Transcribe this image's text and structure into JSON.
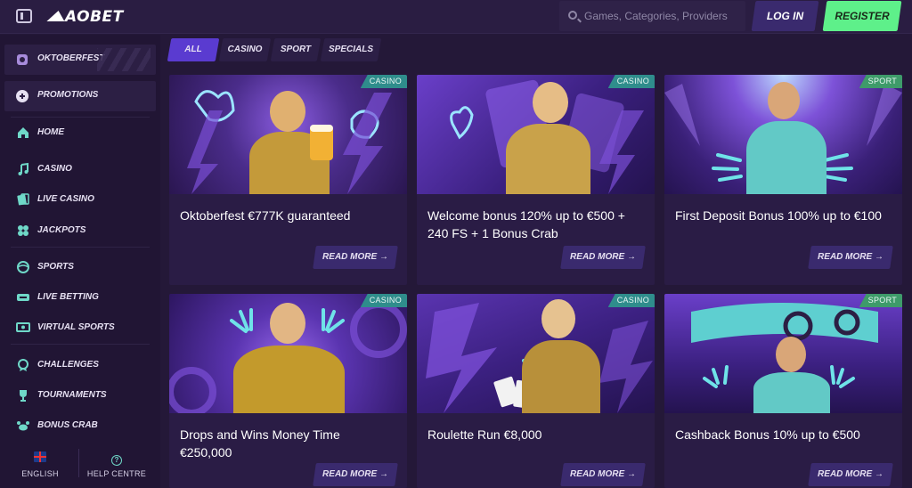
{
  "brand": {
    "logo_text": "AOBET"
  },
  "header": {
    "search_placeholder": "Games, Categories, Providers",
    "login_label": "LOG IN",
    "register_label": "REGISTER"
  },
  "sidebar": {
    "featured": [
      {
        "label": "OKTOBERFEST",
        "icon": "pretzel-icon"
      },
      {
        "label": "PROMOTIONS",
        "icon": "gift-icon"
      }
    ],
    "groups": [
      [
        {
          "label": "HOME",
          "icon": "home-icon"
        },
        {
          "label": "CASINO",
          "icon": "music-note-icon"
        },
        {
          "label": "LIVE CASINO",
          "icon": "cards-icon"
        },
        {
          "label": "JACKPOTS",
          "icon": "clover-icon"
        }
      ],
      [
        {
          "label": "SPORTS",
          "icon": "ball-icon"
        },
        {
          "label": "LIVE BETTING",
          "icon": "live-icon"
        },
        {
          "label": "VIRTUAL SPORTS",
          "icon": "monitor-icon"
        }
      ],
      [
        {
          "label": "CHALLENGES",
          "icon": "medal-icon"
        },
        {
          "label": "TOURNAMENTS",
          "icon": "trophy-icon"
        },
        {
          "label": "BONUS CRAB",
          "icon": "crab-icon"
        }
      ]
    ],
    "language_label": "ENGLISH",
    "help_label": "HELP CENTRE"
  },
  "filters": [
    "ALL",
    "CASINO",
    "SPORT",
    "SPECIALS"
  ],
  "active_filter": "ALL",
  "cards": [
    {
      "tag": "CASINO",
      "title": "Oktoberfest €777K guaranteed",
      "cta": "READ MORE →"
    },
    {
      "tag": "CASINO",
      "title": "Welcome bonus 120% up to €500 + 240 FS + 1 Bonus Crab",
      "cta": "READ MORE →"
    },
    {
      "tag": "SPORT",
      "title": "First Deposit Bonus 100% up to €100",
      "cta": "READ MORE →"
    },
    {
      "tag": "CASINO",
      "title": "Drops and Wins Money Time €250,000",
      "cta": "READ MORE →"
    },
    {
      "tag": "CASINO",
      "title": "Roulette Run €8,000",
      "cta": "READ MORE →"
    },
    {
      "tag": "SPORT",
      "title": "Cashback Bonus 10% up to €500",
      "cta": "READ MORE →"
    }
  ],
  "colors": {
    "background": "#241838",
    "accent_purple": "#5a3bd0",
    "register_green": "#5ef08a",
    "tag_casino": "#2f8d8c",
    "tag_sport": "#3e9b6a",
    "icon_teal": "#6fd8c8"
  }
}
